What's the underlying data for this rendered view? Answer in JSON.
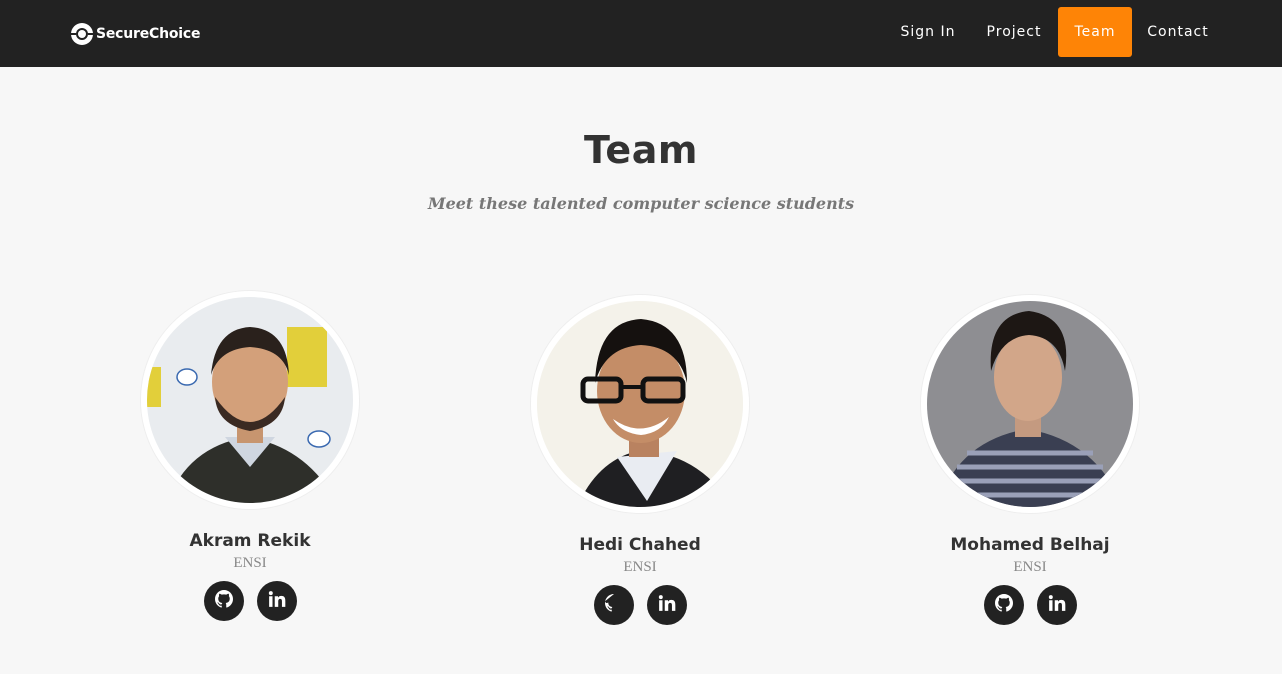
{
  "brand": {
    "name": "SecureChoice",
    "logo_icon": "circle-logo-icon"
  },
  "nav": {
    "items": [
      {
        "label": "Sign In"
      },
      {
        "label": "Project"
      },
      {
        "label": "Team",
        "active": true
      },
      {
        "label": "Contact"
      }
    ],
    "active_color": "#fe8406"
  },
  "team": {
    "title": "Team",
    "subtitle": "Meet these talented computer science students",
    "members": [
      {
        "name": "Akram Rekik",
        "school": "ENSI",
        "socials": [
          "github-icon",
          "linkedin-icon"
        ]
      },
      {
        "name": "Hedi Chahed",
        "school": "ENSI",
        "socials": [
          "github-icon",
          "linkedin-icon"
        ]
      },
      {
        "name": "Mohamed Belhaj",
        "school": "ENSI",
        "socials": [
          "github-icon",
          "linkedin-icon"
        ]
      }
    ]
  },
  "colors": {
    "navbar": "#222222",
    "background": "#f7f7f7",
    "accent": "#fe8406",
    "heading": "#333333"
  }
}
